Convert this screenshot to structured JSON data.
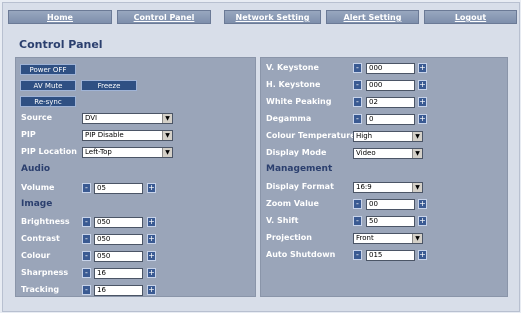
{
  "nav": {
    "home": "Home",
    "control_panel": "Control Panel",
    "network_setting": "Network Setting",
    "alert_setting": "Alert Setting",
    "logout": "Logout"
  },
  "page_title": "Control Panel",
  "left": {
    "buttons": {
      "power_off": "Power OFF",
      "av_mute": "AV Mute",
      "freeze": "Freeze",
      "resync": "Re-sync"
    },
    "source": {
      "label": "Source",
      "value": "DVI"
    },
    "pip": {
      "label": "PIP",
      "value": "PIP Disable"
    },
    "pip_location": {
      "label": "PIP Location",
      "value": "Left-Top"
    },
    "audio_heading": "Audio",
    "volume": {
      "label": "Volume",
      "value": "05"
    },
    "image_heading": "Image",
    "brightness": {
      "label": "Brightness",
      "value": "050"
    },
    "contrast": {
      "label": "Contrast",
      "value": "050"
    },
    "colour": {
      "label": "Colour",
      "value": "050"
    },
    "sharpness": {
      "label": "Sharpness",
      "value": "16"
    },
    "tracking": {
      "label": "Tracking",
      "value": "16"
    }
  },
  "right": {
    "v_keystone": {
      "label": "V. Keystone",
      "value": "000"
    },
    "h_keystone": {
      "label": "H. Keystone",
      "value": "000"
    },
    "white_peaking": {
      "label": "White Peaking",
      "value": "02"
    },
    "degamma": {
      "label": "Degamma",
      "value": "0"
    },
    "colour_temperature": {
      "label": "Colour Temperature",
      "value": "High"
    },
    "display_mode": {
      "label": "Display Mode",
      "value": "Video"
    },
    "management_heading": "Management",
    "display_format": {
      "label": "Display Format",
      "value": "16:9"
    },
    "zoom_value": {
      "label": "Zoom Value",
      "value": "00"
    },
    "v_shift": {
      "label": "V. Shift",
      "value": "50"
    },
    "projection": {
      "label": "Projection",
      "value": "Front"
    },
    "auto_shutdown": {
      "label": "Auto Shutdown",
      "value": "015"
    }
  },
  "stepper": {
    "minus": "-",
    "plus": "+"
  },
  "dropdown_arrow": "▼",
  "colors": {
    "nav_bg": "#8a9ab5",
    "panel_bg": "#9aa5b9",
    "button_bg": "#2f5083",
    "heading": "#2b3f6e"
  }
}
